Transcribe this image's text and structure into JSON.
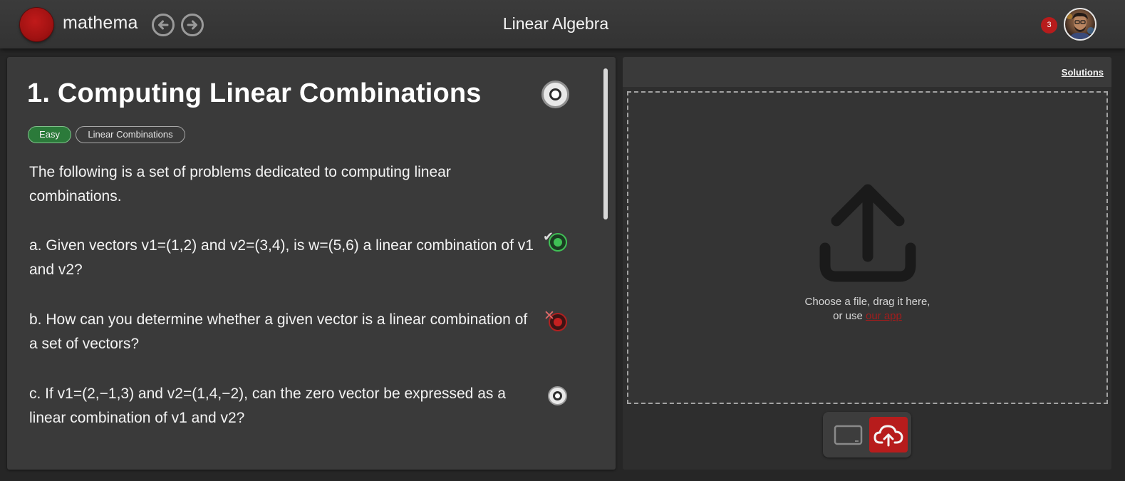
{
  "app": {
    "name": "mathema",
    "page_title": "Linear Algebra",
    "notification_count": "3"
  },
  "problem": {
    "title": "1. Computing Linear Combinations",
    "tags": [
      "Easy",
      "Linear Combinations"
    ],
    "intro": "The following is a set of problems dedicated to computing linear combinations.",
    "questions": [
      {
        "text": "a. Given vectors v1=(1,2) and v2=(3,4), is w=(5,6) a linear combination of v1 and v2?",
        "status": "correct"
      },
      {
        "text": "b. How can you determine whether a given vector is a linear combination of a set of vectors?",
        "status": "incorrect"
      },
      {
        "text": "c. If v1=(2,−1,3) and v2=(1,4,−2), can the zero vector be expressed as a linear combination of v1 and v2?",
        "status": "unanswered"
      }
    ]
  },
  "submission": {
    "solutions_label": "Solutions",
    "drop_line1": "Choose a file, drag it here,",
    "drop_prefix": "or use ",
    "app_link": "our app",
    "modes": [
      "tablet",
      "upload"
    ],
    "active_mode": "upload"
  },
  "colors": {
    "brand_red": "#b71c1c",
    "correct_green": "#3fbf55",
    "easy_tag": "#2b7a3a",
    "background": "#262626",
    "panel": "#3a3a3a"
  },
  "icons": {
    "back": "arrow-left-circle-icon",
    "forward": "arrow-right-circle-icon",
    "upload_large": "upload-tray-icon",
    "tablet": "tablet-icon",
    "cloud_upload": "cloud-upload-icon"
  }
}
